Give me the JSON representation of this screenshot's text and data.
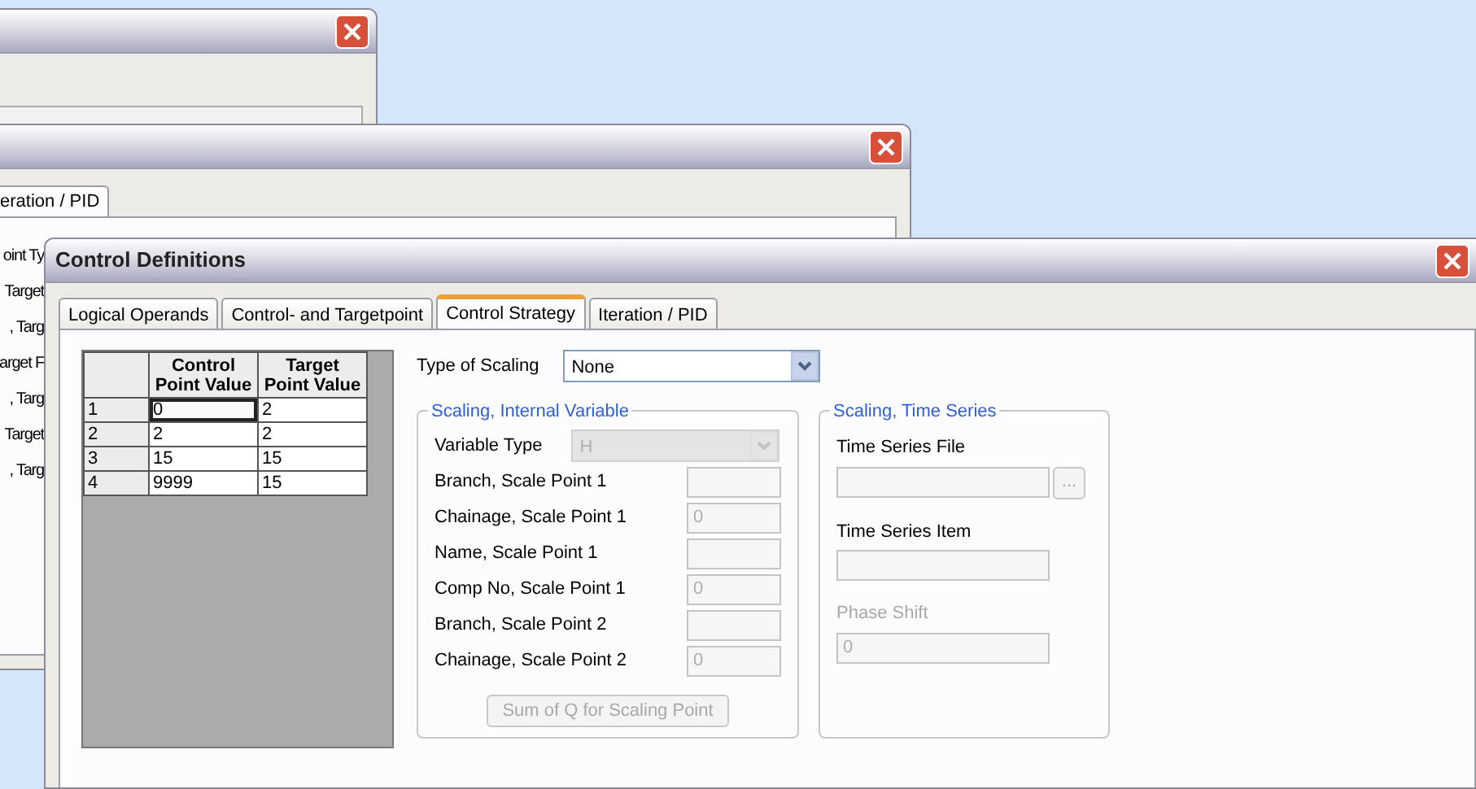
{
  "back_window_2": {
    "tab": "eration / PID",
    "side_labels": [
      "oint Ty",
      "Target",
      ", Targ",
      "arget F",
      ", Targ",
      "Target",
      ", Targ"
    ]
  },
  "window": {
    "title": "Control Definitions",
    "tabs": [
      {
        "label": "Logical Operands",
        "selected": false
      },
      {
        "label": "Control- and Targetpoint",
        "selected": false
      },
      {
        "label": "Control Strategy",
        "selected": true
      },
      {
        "label": "Iteration / PID",
        "selected": false
      }
    ],
    "grid": {
      "columns": [
        "Control Point Value",
        "Target Point Value"
      ],
      "rows": [
        {
          "index": "1",
          "cells": [
            {
              "text": "0",
              "selected": true
            },
            {
              "text": "2",
              "selected": false
            }
          ]
        },
        {
          "index": "2",
          "cells": [
            {
              "text": "2",
              "selected": false
            },
            {
              "text": "2",
              "selected": false
            }
          ]
        },
        {
          "index": "3",
          "cells": [
            {
              "text": "15",
              "selected": false
            },
            {
              "text": "15",
              "selected": false
            }
          ]
        },
        {
          "index": "4",
          "cells": [
            {
              "text": "9999",
              "selected": false
            },
            {
              "text": "15",
              "selected": false
            }
          ]
        }
      ]
    },
    "type_of_scaling": {
      "label": "Type of Scaling",
      "value": "None",
      "disabled": false
    },
    "internal_variable": {
      "title": "Scaling, Internal Variable",
      "variable_type": {
        "label": "Variable Type",
        "value": "H",
        "disabled": true
      },
      "fields": [
        {
          "label": "Branch, Scale Point 1",
          "disabled": true
        },
        {
          "label": "Chainage, Scale Point 1",
          "value": "0",
          "disabled": true
        },
        {
          "label": "Name, Scale Point 1",
          "disabled": true
        },
        {
          "label": "Comp No, Scale Point 1",
          "value": "0",
          "disabled": true
        },
        {
          "label": "Branch, Scale Point 2",
          "disabled": true
        },
        {
          "label": "Chainage, Scale Point 2",
          "value": "0",
          "disabled": true
        }
      ],
      "button": {
        "label": "Sum of Q for Scaling Point",
        "disabled": true
      }
    },
    "time_series": {
      "title": "Scaling, Time Series",
      "file": {
        "label": "Time Series File",
        "disabled": true,
        "browse": "...",
        "label_disabled": false
      },
      "item": {
        "label": "Time Series Item",
        "disabled": true,
        "label_disabled": false
      },
      "phase_shift": {
        "label": "Phase Shift",
        "value": "0",
        "disabled": true,
        "label_disabled": true
      }
    }
  }
}
